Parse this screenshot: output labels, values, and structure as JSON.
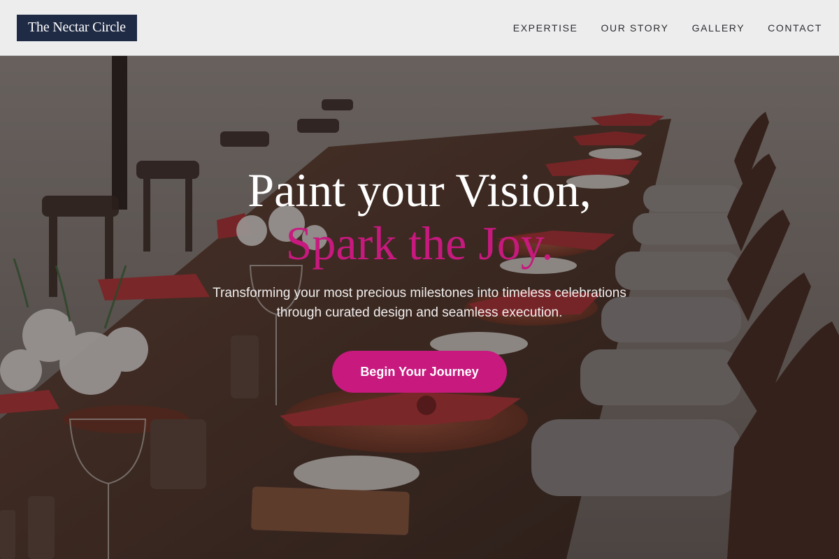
{
  "header": {
    "logo_text": "The Nectar Circle",
    "nav": [
      {
        "label": "EXPERTISE"
      },
      {
        "label": "OUR STORY"
      },
      {
        "label": "GALLERY"
      },
      {
        "label": "CONTACT"
      }
    ]
  },
  "hero": {
    "headline": "Paint your Vision,",
    "headline_accent": "Spark the Joy.",
    "subtext_line1": "Transforming your most precious milestones into timeless celebrations",
    "subtext_line2": "through curated design and seamless execution.",
    "cta_label": "Begin Your Journey",
    "background_image": "outdoor banquet table with red napkins, woven placemats, wine glasses and white flowers"
  },
  "colors": {
    "accent": "#c8197f",
    "logo_bg": "#1f2a44",
    "header_bg": "#f4f4f5",
    "nav_text": "#2b2b2f"
  }
}
